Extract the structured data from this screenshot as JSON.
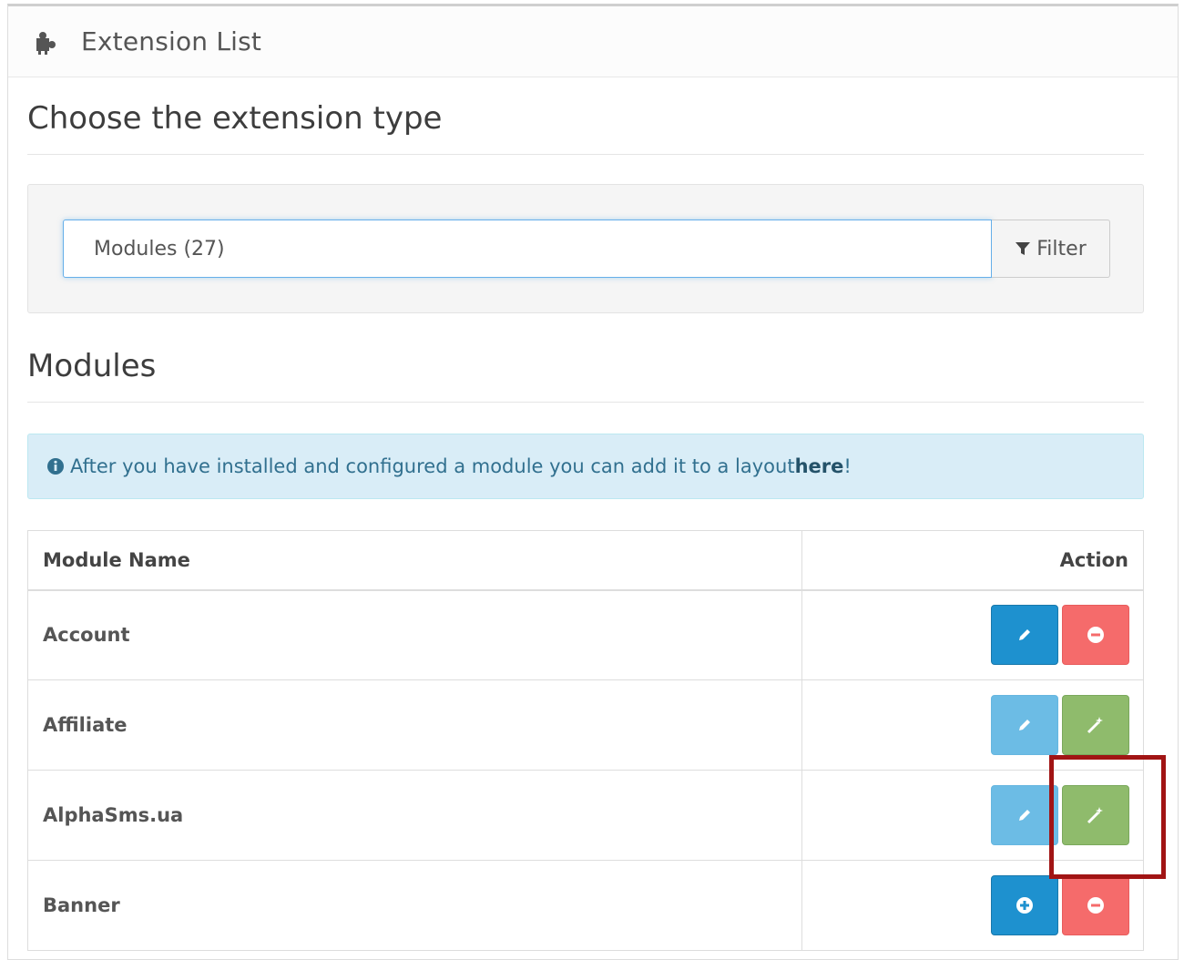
{
  "header": {
    "title": "Extension List",
    "icon": "puzzle-icon"
  },
  "page": {
    "heading": "Choose the extension type"
  },
  "filter": {
    "selected": "Modules (27)",
    "button_label": "Filter",
    "button_icon": "filter-icon"
  },
  "section": {
    "heading": "Modules"
  },
  "alert": {
    "icon": "info-circle-icon",
    "text": "After you have installed and configured a module you can add it to a layout ",
    "link": "here",
    "suffix": "!"
  },
  "table": {
    "headers": {
      "name": "Module Name",
      "action": "Action"
    },
    "rows": [
      {
        "name": "Account",
        "actions": [
          "edit",
          "uninstall"
        ]
      },
      {
        "name": "Affiliate",
        "actions": [
          "edit-disabled",
          "install-configure"
        ]
      },
      {
        "name": "AlphaSms.ua",
        "actions": [
          "edit-disabled",
          "install-configure"
        ]
      },
      {
        "name": "Banner",
        "actions": [
          "add",
          "uninstall"
        ]
      }
    ]
  },
  "colors": {
    "primary": "#1e91cf",
    "primary_disabled": "#6cbce5",
    "danger": "#f56b6b",
    "success": "#8fbb6c",
    "highlight": "#a11414"
  }
}
